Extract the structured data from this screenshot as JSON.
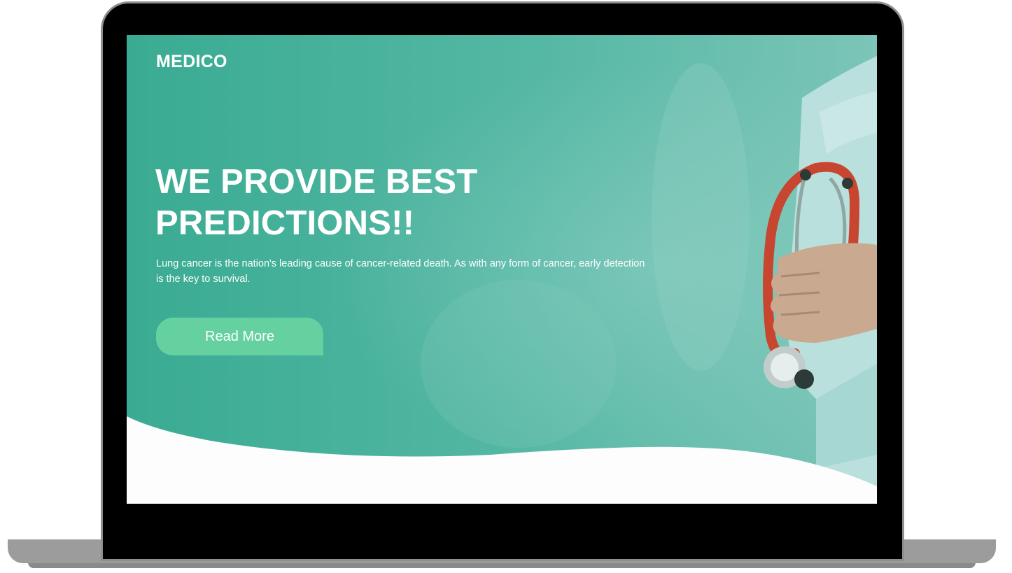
{
  "hero": {
    "brand": "MEDICO",
    "headline_line1": "WE PROVIDE BEST",
    "headline_line2": "PREDICTIONS!!",
    "description": "Lung cancer is the nation's leading cause of cancer-related death. As with any form of cancer, early detection is the key to survival.",
    "cta_label": "Read More"
  },
  "colors": {
    "teal_overlay": "#40ad95",
    "button": "#65d0a0",
    "text": "#ffffff",
    "stethoscope": "#c8452f",
    "laptop_bezel": "#000000",
    "laptop_base": "#9c9c9c"
  },
  "icons": {
    "hero_image": "doctor-with-stethoscope"
  }
}
